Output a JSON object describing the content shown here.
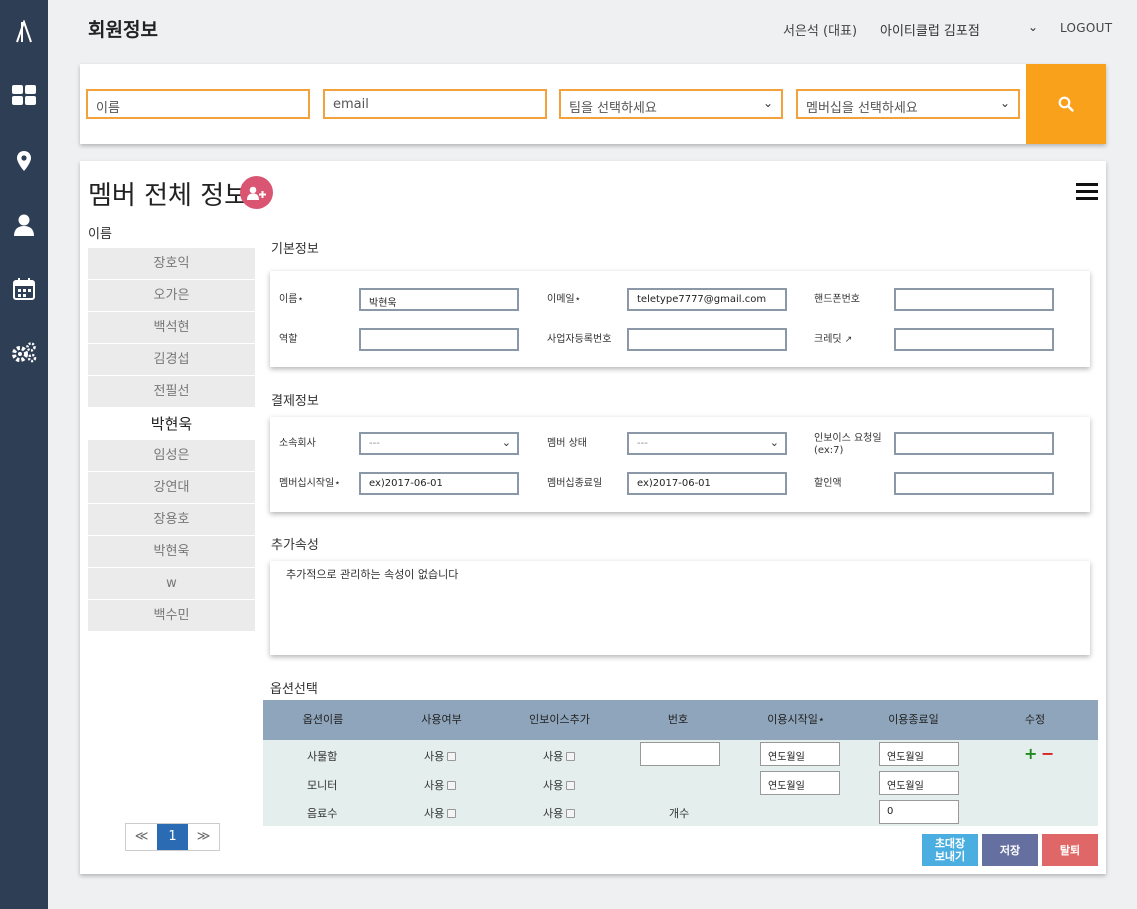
{
  "colors": {
    "rail": "#2e3e54",
    "accent_orange": "#f9a11b",
    "field_border": "#f3a23b",
    "add_user": "#d95572",
    "table_head": "#8fa5bb",
    "invite": "#4aaee0",
    "save": "#6570a0",
    "withdraw": "#e06767"
  },
  "rail": {
    "logo_icon": "logo-icon",
    "icons": [
      "dashboard-icon",
      "location-pin-icon",
      "user-icon",
      "calendar-icon",
      "settings-gears-icon"
    ]
  },
  "header": {
    "title": "회원정보",
    "user": "서은석 (대표)",
    "store": "아이티클럽 김포점",
    "logout": "LOGOUT"
  },
  "search": {
    "name_placeholder": "이름",
    "email_placeholder": "email",
    "team_select": "팀을 선택하세요",
    "membership_select": "멤버십을 선택하세요",
    "button_icon": "search-icon"
  },
  "card": {
    "title": "멤버 전체 정보"
  },
  "members": {
    "label": "이름",
    "names": [
      "장호익",
      "오가은",
      "백석현",
      "김경섭",
      "전필선",
      "박현욱",
      "임성은",
      "강연대",
      "장용호",
      "박현욱",
      "w",
      "백수민"
    ],
    "active_index": 5
  },
  "pagination": {
    "prev": "≪",
    "current": "1",
    "next": "≫"
  },
  "basic": {
    "title": "기본정보",
    "name_label": "이름⋆",
    "name_value": "박현욱",
    "email_label": "이메일⋆",
    "email_value": "teletype7777@gmail.com",
    "phone_label": "핸드폰번호",
    "phone_value": "",
    "role_label": "역할",
    "role_value": "",
    "bizno_label": "사업자등록번호",
    "bizno_value": "",
    "credit_label": "크레딧",
    "credit_value": ""
  },
  "payment": {
    "title": "결제정보",
    "company_label": "소속회사",
    "company_value": "---",
    "status_label": "멤버 상태",
    "status_value": "---",
    "invoice_day_label": "인보이스 요청일",
    "invoice_day_sub": "(ex:7)",
    "invoice_day_value": "",
    "start_label": "멤버십시작일⋆",
    "start_placeholder": "ex)2017-06-01",
    "end_label": "멤버십종료일",
    "end_placeholder": "ex)2017-06-01",
    "discount_label": "할인액",
    "discount_value": ""
  },
  "extra": {
    "title": "추가속성",
    "empty_text": "추가적으로 관리하는 속성이 없습니다"
  },
  "options": {
    "title": "옵션선택",
    "headers": [
      "옵션이름",
      "사용여부",
      "인보이스추가",
      "번호",
      "이용시작일⋆",
      "이용종료일",
      "수정"
    ],
    "rows": [
      {
        "name": "사물함",
        "use": "사용",
        "invoice": "사용",
        "number": "",
        "start": "연도월일",
        "end": "연도월일"
      },
      {
        "name": "모니터",
        "use": "사용",
        "invoice": "사용",
        "start": "연도월일",
        "end": "연도월일"
      },
      {
        "name": "음료수",
        "use": "사용",
        "invoice": "사용",
        "number_text": "개수",
        "end": "0"
      }
    ],
    "add_symbol": "+",
    "remove_symbol": "−"
  },
  "actions": {
    "invite": "초대장\n보내기",
    "save": "저장",
    "withdraw": "탈퇴"
  }
}
